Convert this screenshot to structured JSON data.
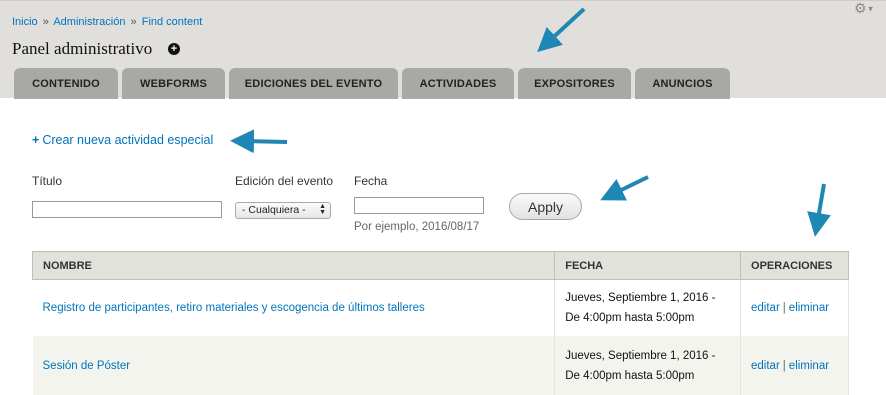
{
  "breadcrumb": {
    "items": [
      "Inicio",
      "Administración",
      "Find content"
    ],
    "separator": "»"
  },
  "page_title": "Panel administrativo",
  "tabs": [
    {
      "label": "CONTENIDO"
    },
    {
      "label": "WEBFORMS"
    },
    {
      "label": "EDICIONES DEL EVENTO"
    },
    {
      "label": "ACTIVIDADES"
    },
    {
      "label": "EXPOSITORES"
    },
    {
      "label": "ANUNCIOS"
    }
  ],
  "create_link": {
    "plus": "+",
    "label": "Crear nueva actividad especial"
  },
  "filters": {
    "title_label": "Título",
    "title_value": "",
    "edition_label": "Edición del evento",
    "edition_value": "- Cualquiera -",
    "date_label": "Fecha",
    "date_value": "",
    "date_hint": "Por ejemplo, 2016/08/17",
    "apply_label": "Apply"
  },
  "table": {
    "headers": [
      "NOMBRE",
      "FECHA",
      "OPERACIONES"
    ],
    "rows": [
      {
        "name": "Registro de participantes, retiro materiales y escogencia de últimos talleres",
        "date_line1": "Jueves, Septiembre 1, 2016 -",
        "date_line2": "De 4:00pm hasta 5:00pm",
        "edit": "editar",
        "delete": "eliminar"
      },
      {
        "name": "Sesión de Póster",
        "date_line1": "Jueves, Septiembre 1, 2016 -",
        "date_line2": "De 4:00pm hasta 5:00pm",
        "edit": "editar",
        "delete": "eliminar"
      }
    ]
  },
  "icons": {
    "gear": "gear-icon",
    "add": "plus-circle-icon",
    "annotation": "arrow-icon"
  },
  "colors": {
    "link": "#0074bd",
    "arrow": "#1e87b4",
    "header_bg": "#e0dfdb",
    "tab_bg": "#a8a8a4"
  }
}
